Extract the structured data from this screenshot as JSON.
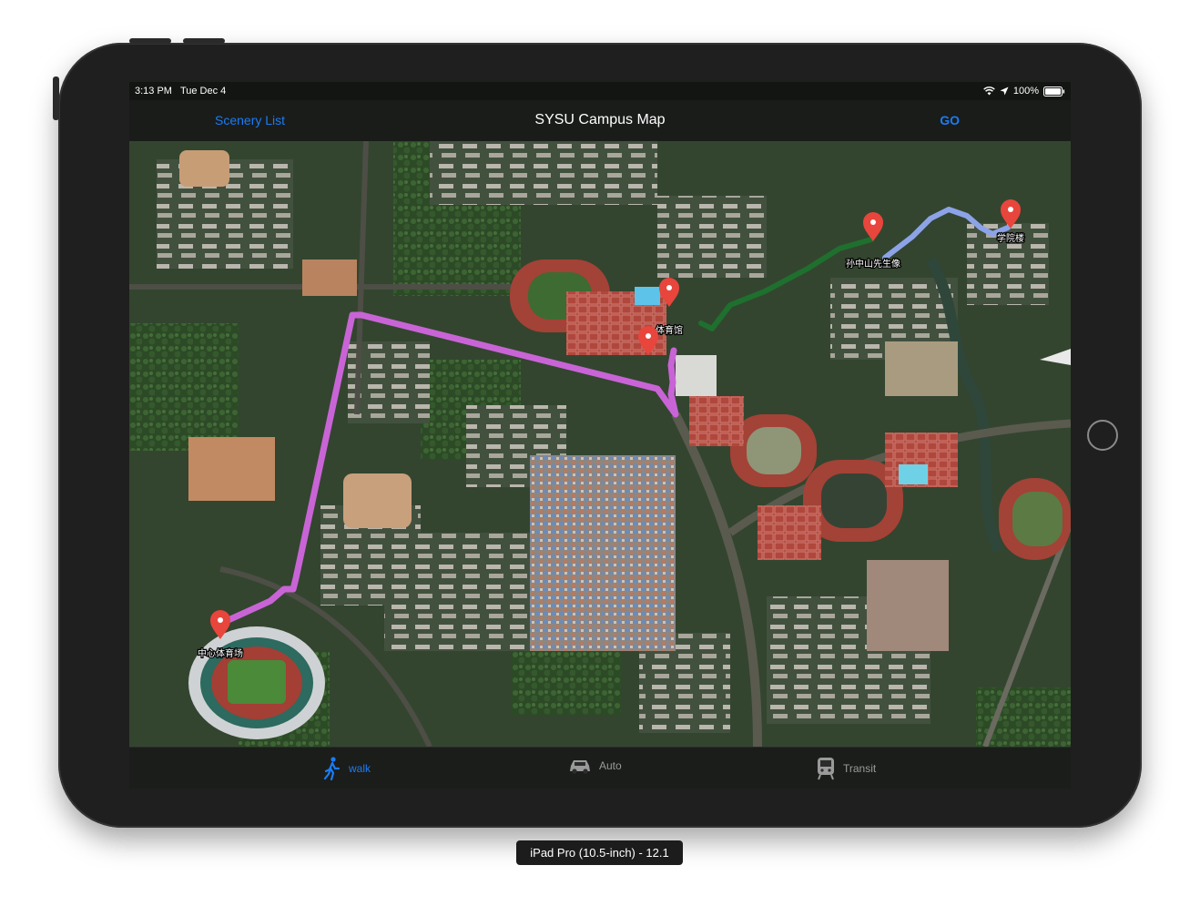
{
  "status_bar": {
    "time": "3:13 PM",
    "date": "Tue Dec 4",
    "battery": "100%"
  },
  "nav": {
    "left_button": "Scenery List",
    "title": "SYSU Campus Map",
    "right_button": "GO"
  },
  "map": {
    "pins": [
      "学院楼",
      "孙中山先生像",
      "体育馆",
      "中心体育场"
    ]
  },
  "tabs": [
    {
      "label": "walk",
      "icon": "walk-icon",
      "active": true
    },
    {
      "label": "Auto",
      "icon": "car-icon",
      "active": false
    },
    {
      "label": "Transit",
      "icon": "train-icon",
      "active": false
    }
  ],
  "device_label": "iPad Pro (10.5-inch) - 12.1",
  "colors": {
    "accent": "#1a7cf5",
    "pin": "#e8453c",
    "route_walk": "#c964d6",
    "route_green": "#1f6f2e",
    "route_blue": "#8da3e8"
  }
}
